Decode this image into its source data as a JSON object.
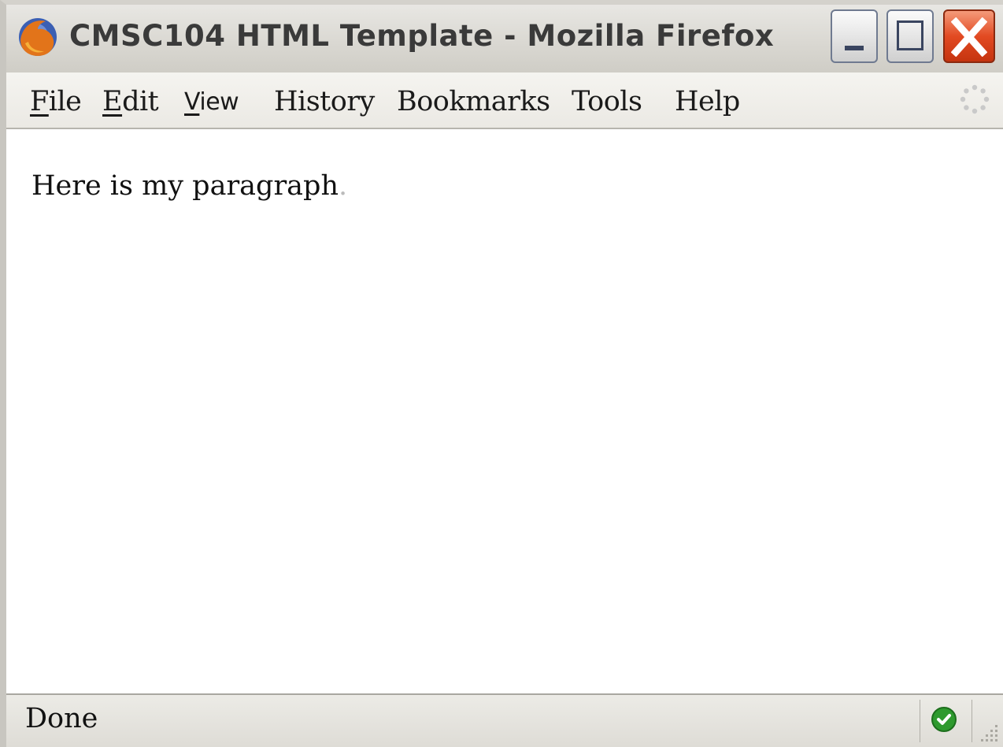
{
  "window": {
    "title": "CMSC104 HTML Template - Mozilla Firefox",
    "app_icon": "firefox-icon"
  },
  "title_buttons": {
    "minimize": "minimize-icon",
    "maximize": "maximize-icon",
    "close": "close-icon"
  },
  "menubar": {
    "items": [
      {
        "label": "File",
        "access": "F",
        "rest": "ile"
      },
      {
        "label": "Edit",
        "access": "E",
        "rest": "dit"
      },
      {
        "label": "View",
        "access": "V",
        "rest": "iew"
      },
      {
        "label": "History"
      },
      {
        "label": "Bookmarks"
      },
      {
        "label": "Tools"
      },
      {
        "label": "Help"
      }
    ],
    "throbber_icon": "loading-throbber-icon"
  },
  "content": {
    "paragraph_text": "Here is my paragraph",
    "paragraph_end": "."
  },
  "statusbar": {
    "status_text": "Done",
    "security_icon": "check-icon",
    "grip_icon": "resize-grip-icon"
  },
  "colors": {
    "close_button": "#e24a22",
    "status_ok": "#2e9a2e"
  }
}
